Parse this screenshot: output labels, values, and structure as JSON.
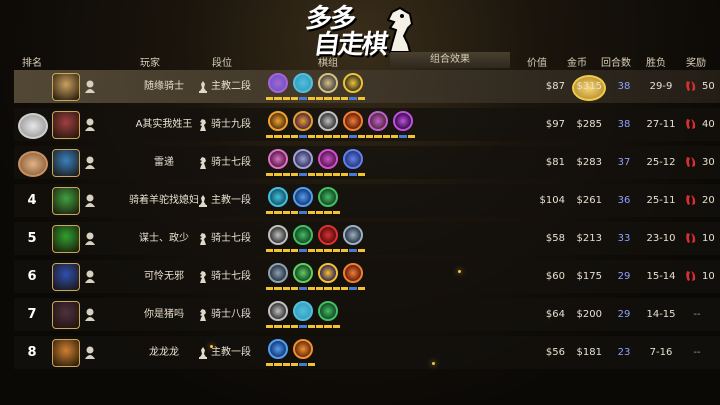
{
  "logo": {
    "line1": "多多",
    "line2": "自走棋"
  },
  "headers": {
    "rank": "排名",
    "player": "玩家",
    "tier": "段位",
    "units": "棋组",
    "combo": "组合效果",
    "value": "价值",
    "gold": "金币",
    "rounds": "回合数",
    "wl": "胜负",
    "reward": "奖励"
  },
  "colors": {
    "accent": "#f2c230",
    "rounds": "#8ea0ff",
    "reward": "#d83030"
  },
  "rows": [
    {
      "rank": "",
      "medal": "gold",
      "avatar_color": "#c9a060",
      "name": "随缘骑士",
      "tier": "主教二段",
      "tier_icon": "bishop-icon",
      "units": [
        [
          "#6a5acd",
          "#b060d0"
        ],
        [
          "#3aa0c0",
          "#50c0e0"
        ],
        [
          "#4a4a4a",
          "#d8c080"
        ],
        [
          "#3a3a2a",
          "#f2c230"
        ]
      ],
      "price": "$87",
      "gold": "$315",
      "rounds": "38",
      "wl": "29-9",
      "reward": "50",
      "reward_icon": "candy-icon"
    },
    {
      "rank": "",
      "medal": "silver",
      "avatar_color": "#a04040",
      "name": "A其实我姓王",
      "tier": "骑士九段",
      "tier_icon": "knight-icon",
      "units": [
        [
          "#5a3a10",
          "#f2a030"
        ],
        [
          "#5a2a40",
          "#e0a030"
        ],
        [
          "#3a3a3a",
          "#c0c0c0"
        ],
        [
          "#6a2010",
          "#f08030"
        ],
        [
          "#5a2a40",
          "#c060d0"
        ],
        [
          "#3a1050",
          "#c050e0"
        ]
      ],
      "price": "$97",
      "gold": "$285",
      "rounds": "38",
      "wl": "27-11",
      "reward": "40",
      "reward_icon": "candy-icon"
    },
    {
      "rank": "",
      "medal": "bronze",
      "avatar_color": "#3a80c0",
      "name": "雷递",
      "tier": "骑士七段",
      "tier_icon": "knight-icon",
      "units": [
        [
          "#5a2050",
          "#e070c0"
        ],
        [
          "#3a3a5a",
          "#a0a0e0"
        ],
        [
          "#5a1a50",
          "#d050d0"
        ],
        [
          "#2a3a7a",
          "#6080f0"
        ]
      ],
      "price": "$81",
      "gold": "$283",
      "rounds": "37",
      "wl": "25-12",
      "reward": "30",
      "reward_icon": "candy-icon"
    },
    {
      "rank": "4",
      "medal": "",
      "avatar_color": "#40a040",
      "name": "骑着羊驼找媳妇",
      "tier": "主教一段",
      "tier_icon": "bishop-icon",
      "units": [
        [
          "#1a5a6a",
          "#40c0e0"
        ],
        [
          "#1a3a7a",
          "#50a0f0"
        ],
        [
          "#1a4a2a",
          "#40c060"
        ]
      ],
      "price": "$104",
      "gold": "$261",
      "rounds": "36",
      "wl": "25-11",
      "reward": "20",
      "reward_icon": "candy-icon"
    },
    {
      "rank": "5",
      "medal": "",
      "avatar_color": "#30a030",
      "name": "谋士、政少",
      "tier": "骑士七段",
      "tier_icon": "knight-icon",
      "units": [
        [
          "#3a3a3a",
          "#c0c0c0"
        ],
        [
          "#1a4a2a",
          "#40c060"
        ],
        [
          "#5a1010",
          "#e03030"
        ],
        [
          "#2a3a4a",
          "#a0b0c0"
        ]
      ],
      "price": "$58",
      "gold": "$213",
      "rounds": "33",
      "wl": "23-10",
      "reward": "10",
      "reward_icon": "candy-icon"
    },
    {
      "rank": "6",
      "medal": "",
      "avatar_color": "#3050b0",
      "name": "可怜无邪",
      "tier": "骑士七段",
      "tier_icon": "knight-icon",
      "units": [
        [
          "#2a3a4a",
          "#90a0b0"
        ],
        [
          "#1a4a2a",
          "#60d060"
        ],
        [
          "#3a2a5a",
          "#f2c230"
        ],
        [
          "#6a2010",
          "#f08030"
        ]
      ],
      "price": "$60",
      "gold": "$175",
      "rounds": "29",
      "wl": "15-14",
      "reward": "10",
      "reward_icon": "candy-icon"
    },
    {
      "rank": "7",
      "medal": "",
      "avatar_color": "#503040",
      "name": "你是猪吗",
      "tier": "骑士八段",
      "tier_icon": "knight-icon",
      "units": [
        [
          "#3a3a3a",
          "#c0c0c0"
        ],
        [
          "#3aa0c0",
          "#50c0e0"
        ],
        [
          "#1a4a2a",
          "#40c060"
        ]
      ],
      "price": "$64",
      "gold": "$200",
      "rounds": "29",
      "wl": "14-15",
      "reward": "--",
      "reward_icon": ""
    },
    {
      "rank": "8",
      "medal": "",
      "avatar_color": "#d08030",
      "name": "龙龙龙",
      "tier": "主教一段",
      "tier_icon": "bishop-icon",
      "units": [
        [
          "#1a3a7a",
          "#50a0f0"
        ],
        [
          "#6a3010",
          "#f09030"
        ]
      ],
      "price": "$56",
      "gold": "$181",
      "rounds": "23",
      "wl": "7-16",
      "reward": "--",
      "reward_icon": ""
    }
  ]
}
